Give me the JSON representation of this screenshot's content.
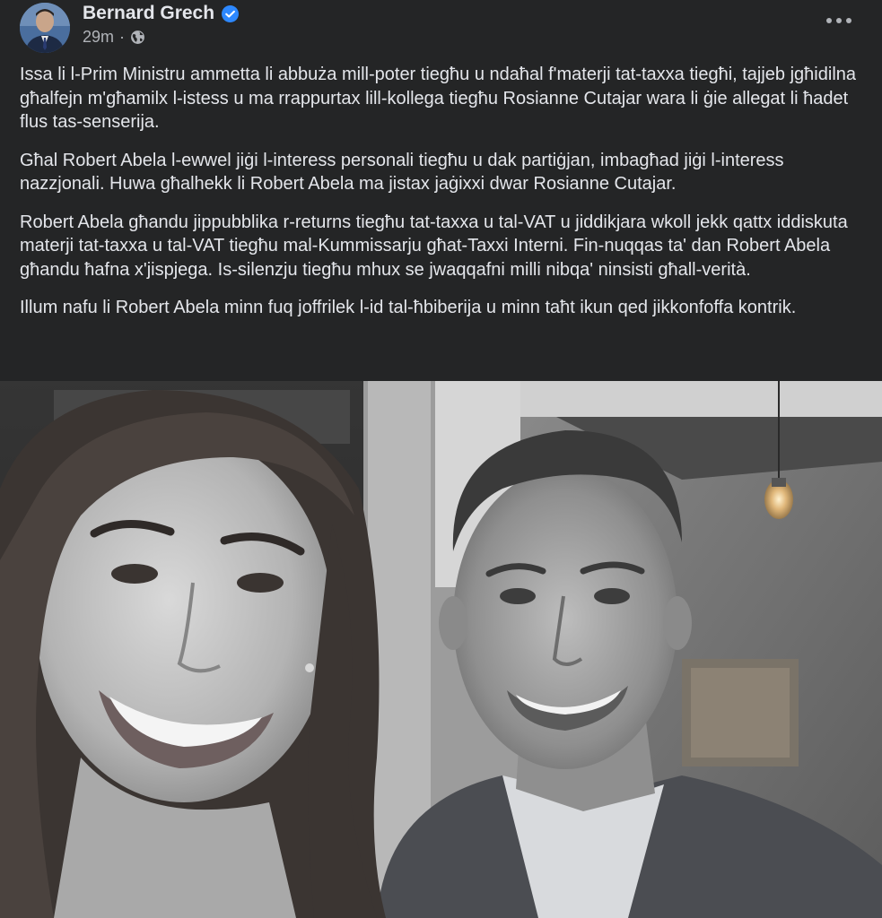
{
  "post": {
    "author": "Bernard Grech",
    "timestamp": "29m",
    "separator": "·",
    "audience_icon": "globe-icon",
    "verified_icon": "verified-badge-icon",
    "more_icon": "more-options-icon",
    "paragraphs": [
      "Issa li l-Prim Ministru ammetta li abbuża mill-poter tiegħu u ndaħal f'materji tat-taxxa tiegħi, tajjeb jgħidilna għalfejn m'għamilx l-istess u ma rrappurtax lill-kollega tiegħu Rosianne Cutajar wara li ġie allegat li ħadet flus tas-senserija.",
      "Għal Robert Abela l-ewwel jiġi l-interess personali tiegħu u dak partiġjan, imbagħad jiġi l-interess nazzjonali. Huwa għalhekk li Robert Abela ma jistax jaġixxi dwar Rosianne Cutajar.",
      "Robert Abela għandu jippubblika r-returns tiegħu tat-taxxa u tal-VAT u jiddikjara wkoll jekk qattx iddiskuta materji tat-taxxa u tal-VAT tiegħu mal-Kummissarju għat-Taxxi Interni. Fin-nuqqas ta' dan Robert Abela għandu ħafna x'jispjega. Is-silenzju tiegħu mhux se jwaqqafni milli nibqa' ninsisti għall-verità.",
      "Illum nafu li Robert Abela minn fuq joffrilek l-id tal-ħbiberija u minn taħt ikun qed jikkonfoffa kontrik."
    ]
  },
  "colors": {
    "background": "#242526",
    "primary_text": "#e4e6eb",
    "secondary_text": "#b0b3b8",
    "verified_blue": "#2d88ff"
  }
}
